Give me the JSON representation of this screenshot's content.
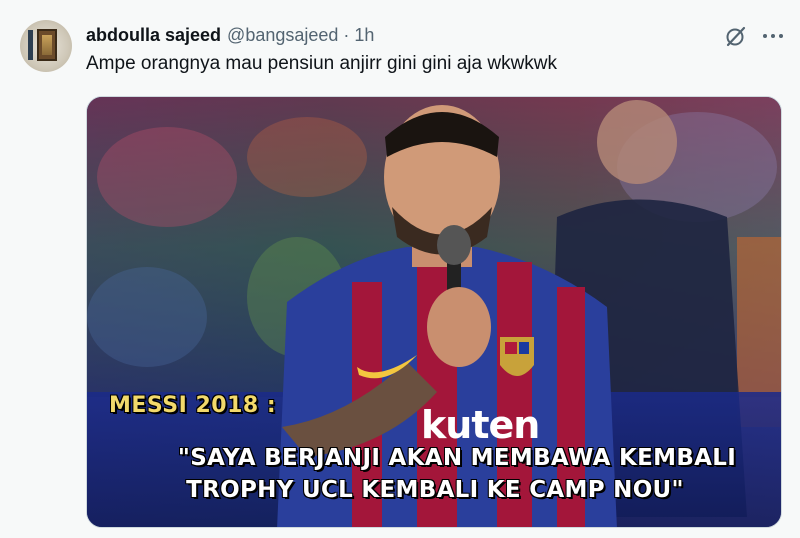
{
  "tweet": {
    "author_name": "abdoulla sajeed",
    "handle": "@bangsajeed",
    "separator": "·",
    "time": "1h",
    "text": "Ampe orangnya mau pensiun anjirr gini gini aja wkwkwk",
    "icons": {
      "avatar": "avatar-image",
      "grok": "grok-icon",
      "more": "more-options-icon"
    }
  },
  "media": {
    "sponsor_text": "kuten",
    "caption_title": "MESSI 2018 :",
    "caption_line1": "\"SAYA BERJANJI AKAN MEMBAWA KEMBALI",
    "caption_line2": "TROPHY UCL KEMBALI KE CAMP NOU\"",
    "colors": {
      "caption_title": "#f2d96b",
      "caption_text": "#ffffff",
      "jersey_blue": "#2a3f9c",
      "jersey_red": "#a3163a"
    }
  }
}
